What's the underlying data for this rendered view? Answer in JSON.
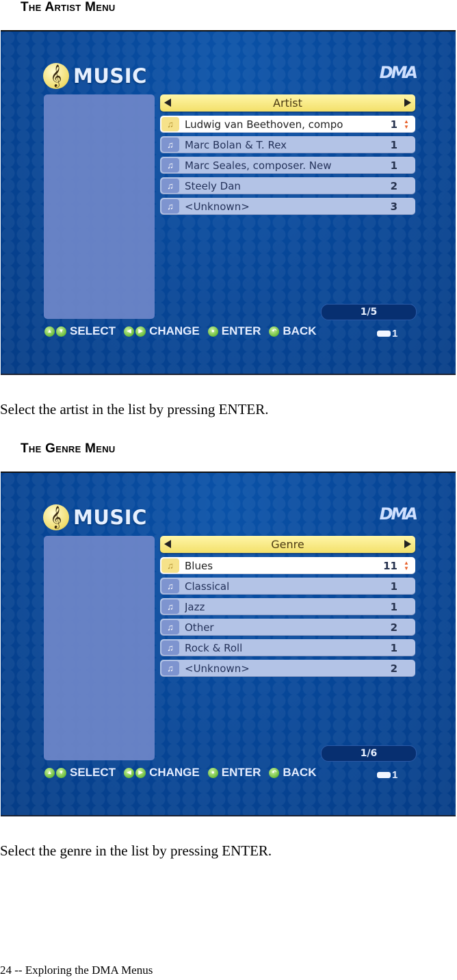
{
  "page": {
    "footer": "24  --  Exploring the DMA Menus"
  },
  "sections": [
    {
      "heading": "The Artist Menu",
      "caption": "Select the artist in the list by pressing ENTER.",
      "screen": {
        "app_title": "MUSIC",
        "brand": "DMA",
        "category": "Artist",
        "items": [
          {
            "name": "Ludwig van Beethoven, compo",
            "count": "1",
            "selected": true
          },
          {
            "name": "Marc Bolan & T. Rex",
            "count": "1",
            "selected": false
          },
          {
            "name": "Marc Seales, composer. New",
            "count": "1",
            "selected": false
          },
          {
            "name": "Steely Dan",
            "count": "2",
            "selected": false
          },
          {
            "name": "<Unknown>",
            "count": "3",
            "selected": false
          }
        ],
        "page_indicator": "1/5",
        "hints": {
          "select": "SELECT",
          "change": "CHANGE",
          "enter": "ENTER",
          "back": "BACK"
        },
        "disc_number": "1"
      }
    },
    {
      "heading": "The Genre Menu",
      "caption": "Select the genre in the list by pressing ENTER.",
      "screen": {
        "app_title": "MUSIC",
        "brand": "DMA",
        "category": "Genre",
        "items": [
          {
            "name": "Blues",
            "count": "11",
            "selected": true
          },
          {
            "name": "Classical",
            "count": "1",
            "selected": false
          },
          {
            "name": "Jazz",
            "count": "1",
            "selected": false
          },
          {
            "name": "Other",
            "count": "2",
            "selected": false
          },
          {
            "name": "Rock & Roll",
            "count": "1",
            "selected": false
          },
          {
            "name": "<Unknown>",
            "count": "2",
            "selected": false
          }
        ],
        "page_indicator": "1/6",
        "hints": {
          "select": "SELECT",
          "change": "CHANGE",
          "enter": "ENTER",
          "back": "BACK"
        },
        "disc_number": "1"
      }
    }
  ],
  "icons": {
    "logo": "treble-clef-icon",
    "folder": "music-folder-icon",
    "up_down": "up-down-arrows-icon",
    "left": "left-arrow-icon",
    "right": "right-arrow-icon",
    "disc": "disc-icon"
  },
  "colors": {
    "screen_bg": "#064596",
    "category_bar": "#f3e06a",
    "row_bg": "#b3c3e6",
    "row_selected": "#ffffff",
    "button_green": "#6cbd3a",
    "updown_arrow": "#e8602a"
  }
}
